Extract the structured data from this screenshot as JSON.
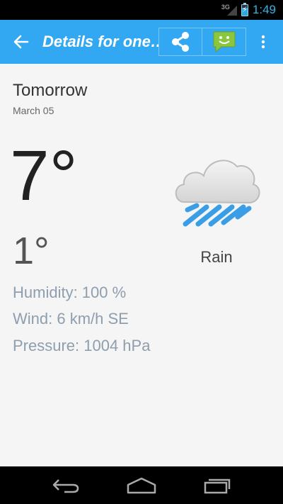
{
  "status_bar": {
    "network": "3G",
    "time": "1:49",
    "battery_level": 0.7
  },
  "action_bar": {
    "title": "Details for one…",
    "icons": [
      "back-arrow-icon",
      "share-icon",
      "message-bubble-icon",
      "overflow-menu-icon"
    ]
  },
  "forecast": {
    "day": "Tomorrow",
    "date": "March 05",
    "high": "7°",
    "low": "1°",
    "condition": "Rain",
    "humidity": "Humidity: 100 %",
    "wind": "Wind: 6 km/h SE",
    "pressure": "Pressure: 1004 hPa"
  },
  "colors": {
    "accent": "#33a8f2",
    "status_clock": "#33b5e5",
    "rain": "#3a9ee6"
  },
  "nav_bar": {
    "icons": [
      "back-icon",
      "home-icon",
      "recent-apps-icon"
    ]
  }
}
